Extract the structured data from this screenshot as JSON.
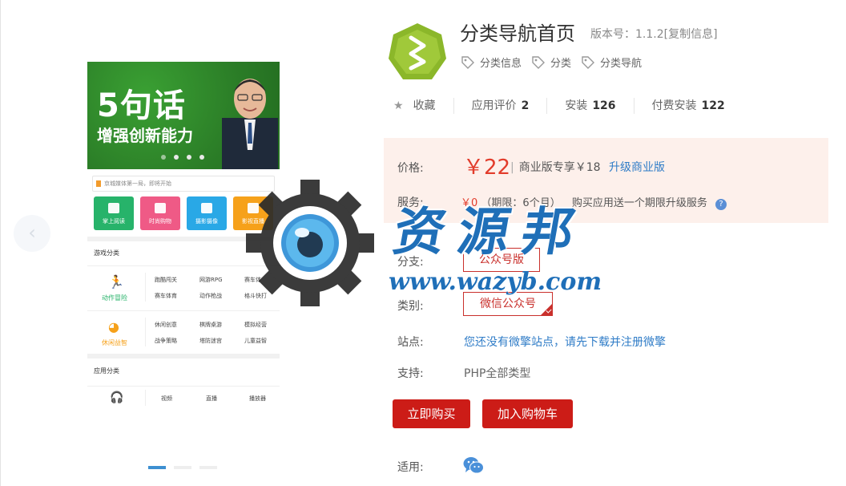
{
  "gallery": {
    "banner": {
      "headline": "5句话",
      "subline": "增强创新能力"
    },
    "notice": "京城媒体第一局，即将开始",
    "tiles": [
      {
        "label": "掌上阅读",
        "color": "#27b36a"
      },
      {
        "label": "时尚购物",
        "color": "#ef5a86"
      },
      {
        "label": "摄影摄像",
        "color": "#29a8e6"
      },
      {
        "label": "影视直播",
        "color": "#f6a11a"
      }
    ],
    "games_title": "游戏分类",
    "categories": [
      {
        "name": "动作冒险",
        "color": "#27b36a",
        "items": [
          "跑酷闯关",
          "网游RPG",
          "赛车体",
          "赛车体育",
          "动作枪战",
          "格斗快打"
        ]
      },
      {
        "name": "休闲益智",
        "color": "#f6a11a",
        "items": [
          "休闲创意",
          "棋牌桌游",
          "模拟经营",
          "战争策略",
          "塔防迷宫",
          "儿童益智"
        ]
      }
    ],
    "apps_title": "应用分类",
    "app_items": [
      "视频",
      "直播",
      "播放器"
    ],
    "prev_arrow": "‹"
  },
  "app": {
    "title": "分类导航首页",
    "version": "版本号：1.1.2[复制信息]",
    "tags": [
      "分类信息",
      "分类",
      "分类导航"
    ],
    "favorite_label": "收藏",
    "stats": [
      {
        "label": "应用评价",
        "value": "2"
      },
      {
        "label": "安装",
        "value": "126"
      },
      {
        "label": "付费安装",
        "value": "122"
      }
    ]
  },
  "price": {
    "label": "价格:",
    "value": "￥22",
    "separator": "|",
    "business_text": "商业版专享￥18",
    "upgrade_link": "升级商业版"
  },
  "service": {
    "label": "服务:",
    "price": "￥0",
    "period": "（期限：6个月）",
    "desc": "购买应用送一个期限升级服务",
    "help": "?"
  },
  "branch": {
    "label": "分支:",
    "option": "公众号版"
  },
  "category": {
    "label": "类别:",
    "option": "微信公众号"
  },
  "site": {
    "label": "站点:",
    "text": "您还没有微擎站点，请先下载并注册微擎"
  },
  "support": {
    "label": "支持:",
    "text": "PHP全部类型"
  },
  "buttons": {
    "buy_now": "立即购买",
    "add_cart": "加入购物车"
  },
  "applies": {
    "label": "适用:",
    "icon": "wechat-icon"
  },
  "watermark": {
    "title": "资源邦",
    "url": "www.wazyb.com"
  },
  "colors": {
    "accent_red": "#cc1c17",
    "link_blue": "#2f7cc7",
    "price_bg": "#fdf0eb"
  }
}
